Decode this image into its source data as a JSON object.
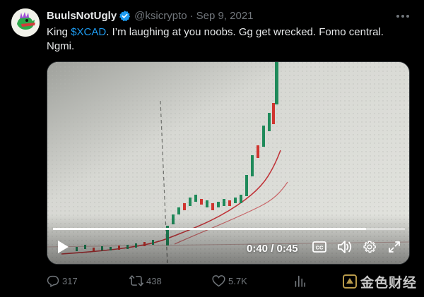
{
  "author": {
    "display_name": "BuulsNotUgly",
    "handle": "@ksicrypto",
    "separator": "·",
    "date": "Sep 9, 2021"
  },
  "tweet": {
    "text_before": "King ",
    "cashtag": "$XCAD",
    "text_after": ". I’m laughing at you noobs. Gg get wrecked. Fomo central. Ngmi."
  },
  "video": {
    "current_time": "0:40",
    "time_separator": " / ",
    "duration": "0:45",
    "progress_fraction": 0.889
  },
  "stats": {
    "replies": "317",
    "retweets": "438",
    "likes": "5.7K"
  },
  "watermark": "金色财经",
  "colors": {
    "accent": "#1d9bf0",
    "background": "#000000",
    "muted": "#71767b",
    "candle_up": "#1f8a5a",
    "candle_down": "#d0352f",
    "moving_average": "#c0353a"
  },
  "icons": [
    "verified-badge-icon",
    "more-icon",
    "play-icon",
    "captions-icon",
    "volume-icon",
    "settings-icon",
    "fullscreen-icon",
    "reply-icon",
    "retweet-icon",
    "like-icon",
    "views-icon",
    "bookmark-icon",
    "share-icon"
  ]
}
